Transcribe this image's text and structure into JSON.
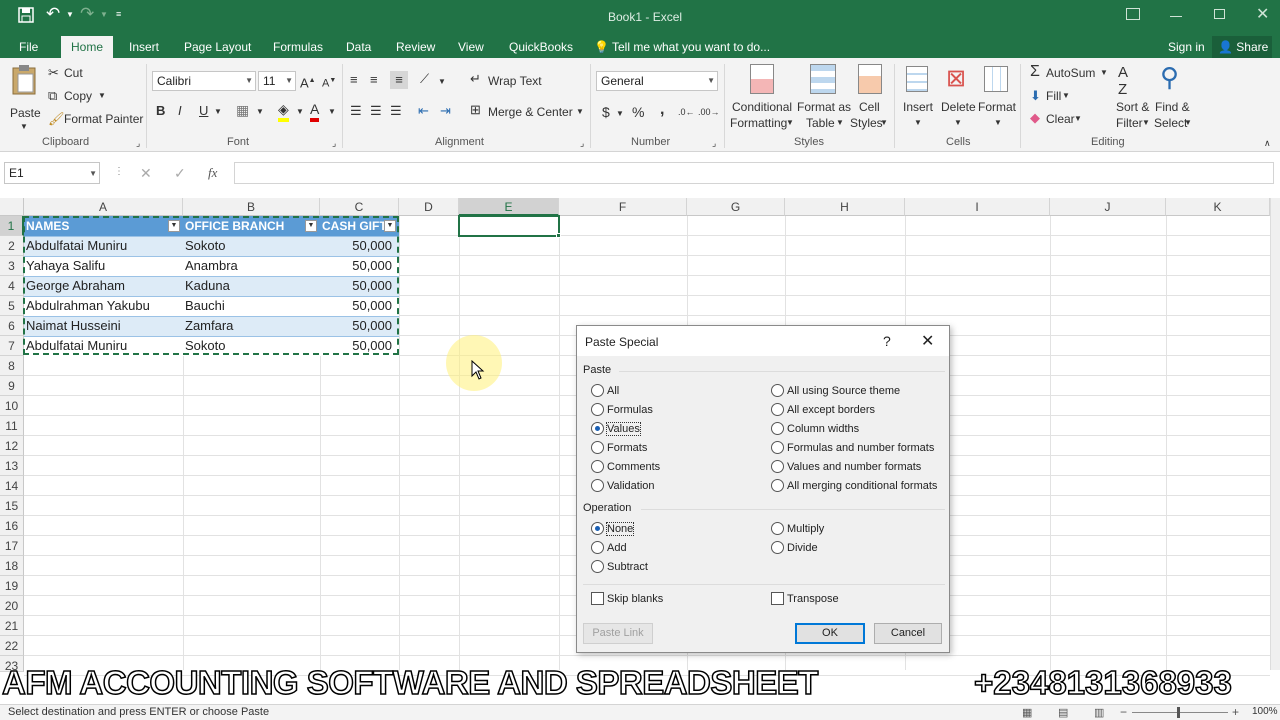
{
  "titlebar": {
    "title": "Book1 - Excel",
    "sign_in": "Sign in",
    "share": "Share"
  },
  "tabs": [
    "File",
    "Home",
    "Insert",
    "Page Layout",
    "Formulas",
    "Data",
    "Review",
    "View",
    "QuickBooks"
  ],
  "tell_me": "Tell me what you want to do...",
  "ribbon": {
    "clipboard": {
      "paste": "Paste",
      "cut": "Cut",
      "copy": "Copy",
      "format_painter": "Format Painter",
      "label": "Clipboard"
    },
    "font": {
      "name": "Calibri",
      "size": "11",
      "label": "Font",
      "bold": "B",
      "italic": "I",
      "underline": "U"
    },
    "alignment": {
      "wrap": "Wrap Text",
      "merge": "Merge & Center",
      "label": "Alignment"
    },
    "number": {
      "format": "General",
      "label": "Number",
      "currency": "$",
      "percent": "%",
      "comma": ","
    },
    "styles": {
      "conditional": [
        "Conditional",
        "Formatting"
      ],
      "format_table": [
        "Format as",
        "Table"
      ],
      "cell_styles": [
        "Cell",
        "Styles"
      ],
      "label": "Styles"
    },
    "cells": {
      "insert": "Insert",
      "delete": "Delete",
      "format": "Format",
      "label": "Cells"
    },
    "editing": {
      "autosum": "AutoSum",
      "fill": "Fill",
      "clear": "Clear",
      "sort": [
        "Sort &",
        "Filter"
      ],
      "find": [
        "Find &",
        "Select"
      ],
      "label": "Editing"
    }
  },
  "formula_bar": {
    "name_box": "E1",
    "fx": "fx",
    "value": ""
  },
  "columns": [
    "A",
    "B",
    "C",
    "D",
    "E",
    "F",
    "G",
    "H",
    "I",
    "J",
    "K"
  ],
  "rows": [
    "1",
    "2",
    "3",
    "4",
    "5",
    "6",
    "7",
    "8",
    "9",
    "10",
    "11",
    "12",
    "13",
    "14",
    "15",
    "16",
    "17",
    "18",
    "19",
    "20",
    "21",
    "22",
    "23"
  ],
  "table": {
    "headers": [
      "NAMES",
      "OFFICE BRANCH",
      "CASH GIFT"
    ],
    "rows": [
      [
        "Abdulfatai Muniru",
        "Sokoto",
        "50,000"
      ],
      [
        "Yahaya Salifu",
        "Anambra",
        "50,000"
      ],
      [
        "George Abraham",
        "Kaduna",
        "50,000"
      ],
      [
        "Abdulrahman Yakubu",
        "Bauchi",
        "50,000"
      ],
      [
        "Naimat Husseini",
        "Zamfara",
        "50,000"
      ],
      [
        "Abdulfatai Muniru",
        "Sokoto",
        "50,000"
      ]
    ]
  },
  "dialog": {
    "title": "Paste Special",
    "help": "?",
    "paste_label": "Paste",
    "paste_left": [
      "All",
      "Formulas",
      "Values",
      "Formats",
      "Comments",
      "Validation"
    ],
    "paste_right": [
      "All using Source theme",
      "All except borders",
      "Column widths",
      "Formulas and number formats",
      "Values and number formats",
      "All merging conditional formats"
    ],
    "paste_selected": "Values",
    "operation_label": "Operation",
    "operation_left": [
      "None",
      "Add",
      "Subtract"
    ],
    "operation_right": [
      "Multiply",
      "Divide"
    ],
    "operation_selected": "None",
    "skip_blanks": "Skip blanks",
    "transpose": "Transpose",
    "paste_link": "Paste Link",
    "ok": "OK",
    "cancel": "Cancel"
  },
  "status": {
    "message": "Select destination and press ENTER or choose Paste",
    "zoom": "100%"
  },
  "overlay": {
    "left": "AFM ACCOUNTING SOFTWARE AND SPREADSHEET",
    "right": "+2348131368933"
  },
  "colors": {
    "excel_green": "#217346",
    "header_blue": "#5b9bd5",
    "band_light": "#ddebf7",
    "selection": "#217346"
  }
}
